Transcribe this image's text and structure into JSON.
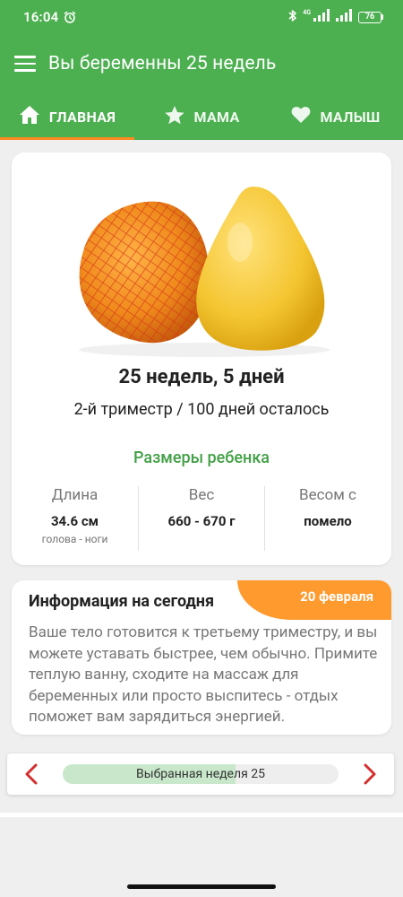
{
  "status_bar": {
    "time": "16:04",
    "network": "4G",
    "battery": "76"
  },
  "app_bar": {
    "title": "Вы беременны 25 недель"
  },
  "tabs": [
    {
      "label": "ГЛАВНАЯ",
      "icon": "home-icon",
      "active": true
    },
    {
      "label": "МАМА",
      "icon": "star-icon",
      "active": false
    },
    {
      "label": "МАЛЫШ",
      "icon": "heart-icon",
      "active": false
    }
  ],
  "main_card": {
    "fruit_image": "pomelo",
    "weeks_days": "25 недель, 5 дней",
    "trimester_info": "2-й триместр / 100 дней осталось",
    "sizes_title": "Размеры ребенка",
    "stats": [
      {
        "label": "Длина",
        "value": "34.6 см",
        "sub": "голова - ноги"
      },
      {
        "label": "Вес",
        "value": "660 - 670 г",
        "sub": ""
      },
      {
        "label": "Весом с",
        "value": "помело",
        "sub": ""
      }
    ]
  },
  "info_card": {
    "title": "Информация на сегодня",
    "date": "20 февраля",
    "text": "Ваше тело готовится к третьему триместру, и вы можете уставать быстрее, чем обычно. Примите теплую ванну, сходите на массаж для беременных или просто выспитесь - отдых поможет вам зарядиться энергией."
  },
  "week_nav": {
    "label": "Выбранная неделя 25",
    "progress": 0.625
  },
  "colors": {
    "primary": "#4caf50",
    "accent": "#ff9a2e",
    "nav_arrow": "#d32f2f",
    "progress_fill": "#c9e8cb"
  }
}
